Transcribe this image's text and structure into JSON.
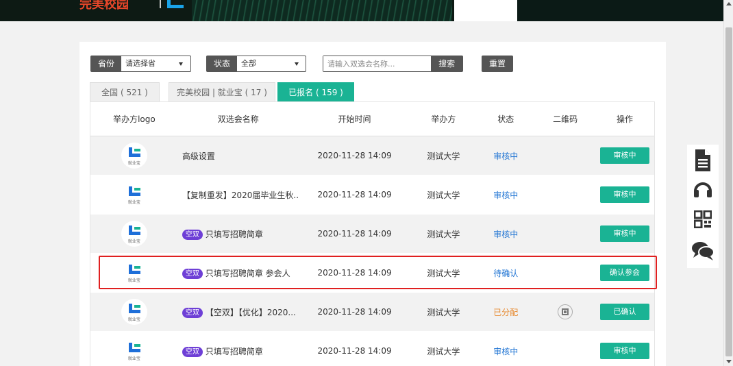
{
  "banner": {
    "logo_text": "完美校园"
  },
  "filters": {
    "province_label": "省份",
    "province_value": "请选择省",
    "status_label": "状态",
    "status_value": "全部",
    "search_placeholder": "请输入双选会名称...",
    "search_button": "搜索",
    "reset_button": "重置"
  },
  "tabs": [
    {
      "label": "全国 ( 521 )"
    },
    {
      "label": "完美校园 | 就业宝 ( 17 )"
    },
    {
      "label": "已报名 ( 159 )"
    }
  ],
  "table": {
    "headers": [
      "举办方logo",
      "双选会名称",
      "开始时间",
      "举办方",
      "状态",
      "二维码",
      "操作"
    ],
    "logo_caption": "就业宝",
    "rows": [
      {
        "tag": "",
        "name": "高级设置",
        "time": "2020-11-28 14:09",
        "host": "测试大学",
        "status": "审核中",
        "status_color": "#1e73d3",
        "qr": false,
        "action": "审核中"
      },
      {
        "tag": "",
        "name": "【复制重发】2020届毕业生秋...",
        "time": "2020-11-28 14:09",
        "host": "测试大学",
        "status": "审核中",
        "status_color": "#1e73d3",
        "qr": false,
        "action": "审核中"
      },
      {
        "tag": "空双",
        "name": "只填写招聘简章",
        "time": "2020-11-28 14:09",
        "host": "测试大学",
        "status": "审核中",
        "status_color": "#1e73d3",
        "qr": false,
        "action": "审核中"
      },
      {
        "tag": "空双",
        "name": "只填写招聘简章 参会人",
        "time": "2020-11-28 14:09",
        "host": "测试大学",
        "status": "待确认",
        "status_color": "#1e73d3",
        "qr": false,
        "action": "确认参会"
      },
      {
        "tag": "空双",
        "name": "【空双】【优化】2020...",
        "time": "2020-11-28 14:09",
        "host": "测试大学",
        "status": "已分配",
        "status_color": "#e7892f",
        "qr": true,
        "action": "已确认"
      },
      {
        "tag": "空双",
        "name": "只填写招聘简章",
        "time": "2020-11-28 14:09",
        "host": "测试大学",
        "status": "审核中",
        "status_color": "#1e73d3",
        "qr": false,
        "action": "审核中"
      }
    ]
  },
  "float_bar": {
    "icons": [
      "document-icon",
      "headset-icon",
      "qrcode-icon",
      "chat-icon"
    ]
  },
  "colors": {
    "accent": "#1ab394",
    "tag": "#6e3fd6",
    "highlight": "#e02020"
  }
}
